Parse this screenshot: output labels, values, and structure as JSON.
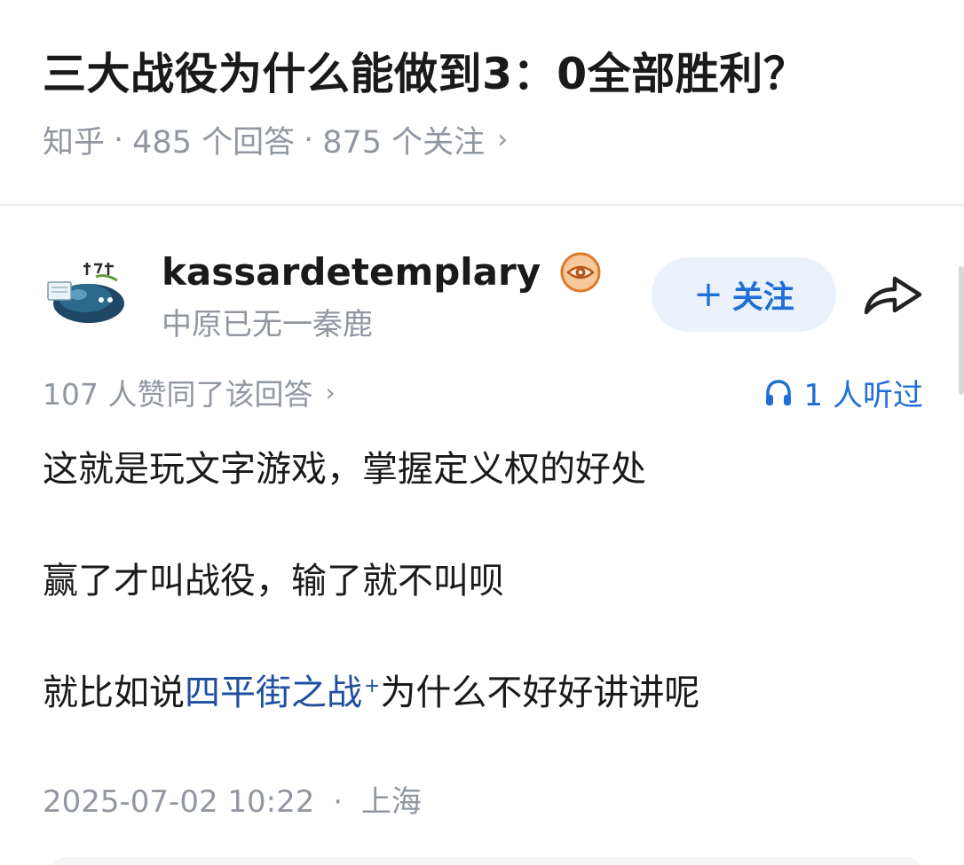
{
  "question": {
    "title": "三大战役为什么能做到3：0全部胜利？",
    "source": "知乎",
    "answers": "485 个回答",
    "followers": "875 个关注",
    "separator": "·",
    "chevron": "›"
  },
  "author": {
    "name": "kassardetemplary",
    "bio": "中原已无一秦鹿",
    "avatar_icon": "avatar-image",
    "badge_icon": "eye-badge-icon",
    "follow_label": "关注",
    "follow_plus": "+",
    "share_icon": "share-icon"
  },
  "answer": {
    "votes": "107 人赞同了该回答",
    "votes_chevron": "›",
    "listen_label": "1 人听过",
    "listen_icon": "headphones-icon",
    "paragraph1": "这就是玩文字游戏，掌握定义权的好处",
    "paragraph2": "赢了才叫战役，输了就不叫呗",
    "paragraph3_before": "就比如说",
    "paragraph3_link": "四平街之战",
    "paragraph3_link_mark": "+",
    "paragraph3_after": "为什么不好好讲讲呢",
    "date": "2025-07-02 10:22",
    "separator": "·",
    "location": "上海"
  },
  "colors": {
    "accent": "#1f6fd6",
    "link": "#1f4fa0",
    "muted": "#9197a1",
    "follow_bg": "#eaf1fb",
    "badge": "#e07a2b"
  }
}
